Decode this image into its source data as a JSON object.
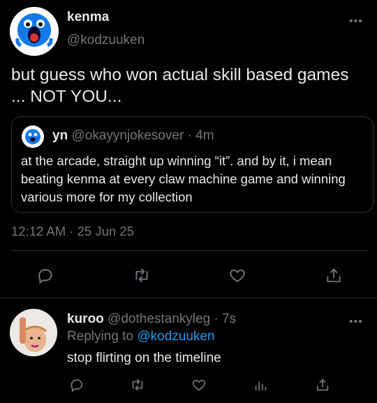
{
  "tweet": {
    "name": "kenma",
    "handle": "@kodzuuken",
    "more": "•••",
    "text_line1": "but guess who won actual skill based games",
    "text_line2": "... NOT YOU...",
    "timestamp": "12:12 AM · 25 Jun 25"
  },
  "quote": {
    "name": "yn",
    "handle": "@okayynjokesover",
    "time": "· 4m",
    "text": "at the arcade, straight up winning “it”. and by it, i mean beating kenma at every claw machine game and winning various more for my collection"
  },
  "actions": [
    "reply-icon",
    "retweet-icon",
    "like-icon",
    "share-icon"
  ],
  "reply": {
    "name": "kuroo",
    "handle": "@dothestankyleg",
    "time": "· 7s",
    "replying_label": "Replying to",
    "replying_to": "@kodzuuken",
    "text": "stop flirting on the timeline",
    "more": "•••",
    "actions": [
      "reply-icon",
      "retweet-icon",
      "like-icon",
      "views-icon",
      "share-icon"
    ]
  },
  "colors": {
    "background": "#000000",
    "text": "#e7e9ea",
    "muted": "#71767b",
    "accent": "#1d9bf0",
    "border": "#2f3336"
  }
}
